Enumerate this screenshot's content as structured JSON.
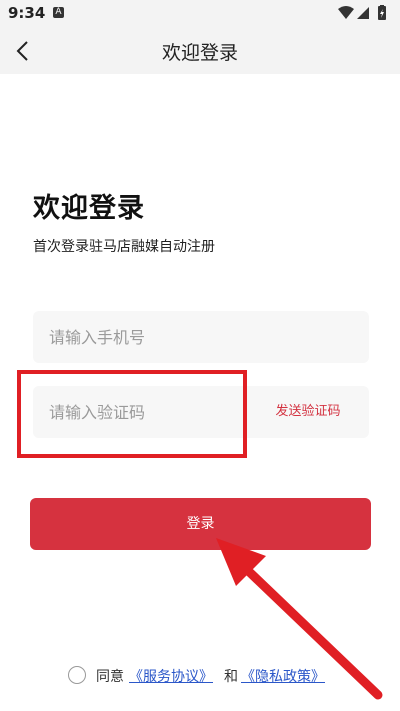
{
  "status_bar": {
    "time": "9:34",
    "notification_icon": "A"
  },
  "nav": {
    "title": "欢迎登录",
    "back_icon": "chevron-left-icon"
  },
  "headline": "欢迎登录",
  "subheadline": "首次登录驻马店融媒自动注册",
  "phone_input": {
    "placeholder": "请输入手机号",
    "value": ""
  },
  "code_input": {
    "placeholder": "请输入验证码",
    "value": ""
  },
  "send_code_label": "发送验证码",
  "login_button_label": "登录",
  "agreement": {
    "agree_label": "同意",
    "service_link": "《服务协议》",
    "and_label": "和",
    "privacy_link": "《隐私政策》"
  },
  "colors": {
    "accent": "#d6323f",
    "link": "#2b57c9",
    "annotation": "#e01f24"
  }
}
